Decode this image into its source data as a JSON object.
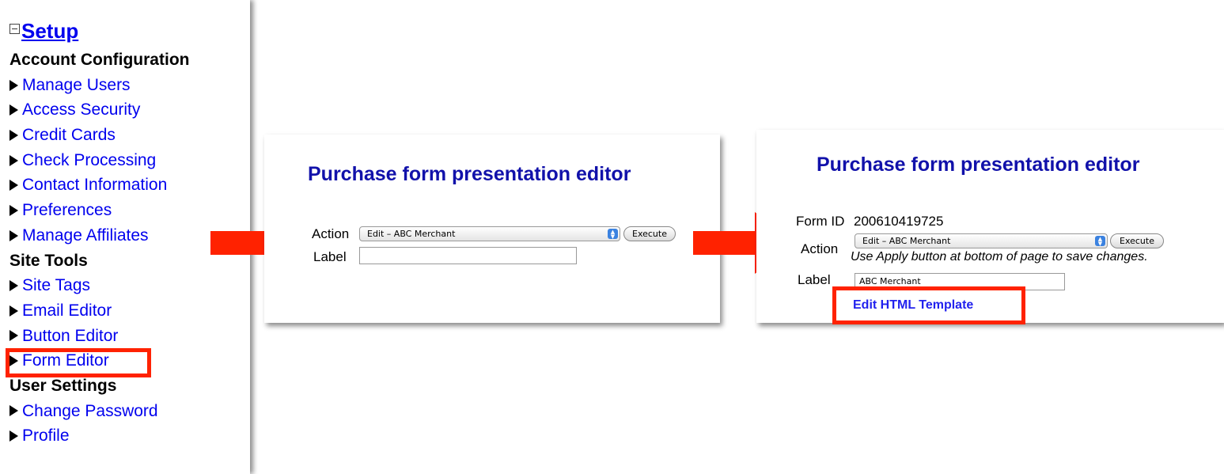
{
  "sidebar": {
    "title": "Setup",
    "sections": [
      {
        "heading": "Account Configuration",
        "items": [
          "Manage Users",
          "Access Security",
          "Credit Cards",
          "Check Processing",
          "Contact Information",
          "Preferences",
          "Manage Affiliates"
        ]
      },
      {
        "heading": "Site Tools",
        "items": [
          "Site Tags",
          "Email Editor",
          "Button Editor",
          "Form Editor"
        ]
      },
      {
        "heading": "User Settings",
        "items": [
          "Change Password",
          "Profile"
        ]
      }
    ],
    "highlighted_item": "Form Editor"
  },
  "editor_step1": {
    "title": "Purchase form presentation editor",
    "action_label": "Action",
    "action_selected": "Edit – ABC Merchant",
    "execute_label": "Execute",
    "label_label": "Label",
    "label_value": ""
  },
  "editor_step2": {
    "title": "Purchase form presentation editor",
    "form_id_label": "Form ID",
    "form_id_value": "200610419725",
    "action_label": "Action",
    "action_selected": "Edit – ABC Merchant",
    "execute_label": "Execute",
    "hint": "Use Apply button at bottom of page to save changes.",
    "label_label": "Label",
    "label_value": "ABC Merchant",
    "edit_template_link": "Edit HTML Template"
  },
  "colors": {
    "link": "#0000ee",
    "title": "#1111aa",
    "highlight": "#ff2200",
    "arrow": "#ff2200"
  },
  "icons": [
    "collapse-minus-icon",
    "triangle-right-icon",
    "arrow-right-icon",
    "select-stepper-icon"
  ]
}
